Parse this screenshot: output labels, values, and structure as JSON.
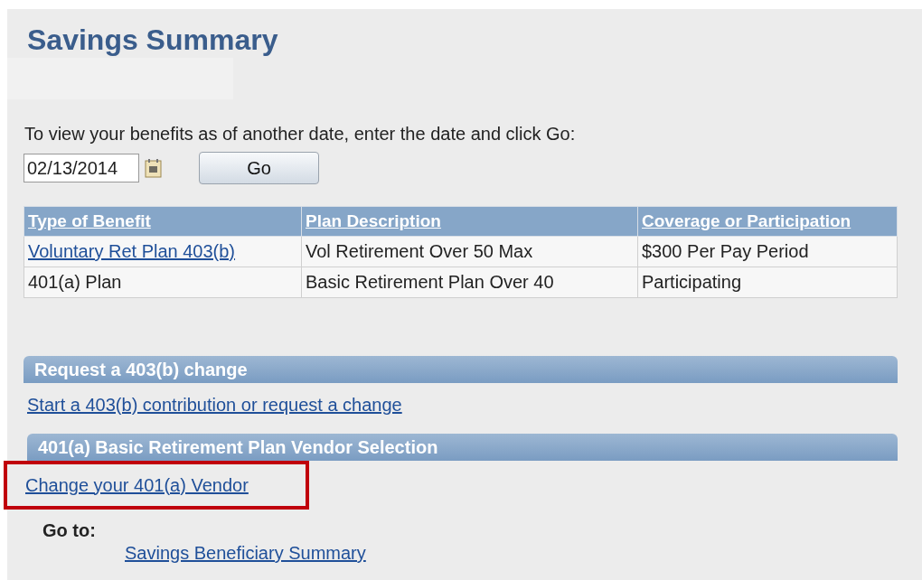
{
  "title": "Savings Summary",
  "date_prompt": "To view your benefits as of another date, enter the date and click Go:",
  "date_field": {
    "value": "02/13/2014",
    "button": "Go"
  },
  "table": {
    "columns": [
      "Type of Benefit",
      "Plan Description",
      "Coverage or Participation"
    ],
    "rows": [
      {
        "cells": [
          "Voluntary Ret Plan 403(b)",
          "Vol Retirement Over 50 Max",
          "$300 Per Pay Period"
        ],
        "link_first": true
      },
      {
        "cells": [
          "401(a) Plan",
          "Basic Retirement Plan Over 40",
          "Participating"
        ],
        "link_first": false
      }
    ]
  },
  "sections": [
    {
      "heading": "Request a 403(b) change",
      "link": "Start a 403(b) contribution or request a change",
      "highlighted": false
    },
    {
      "heading": "401(a) Basic Retirement Plan Vendor Selection",
      "link": "Change your 401(a) Vendor",
      "highlighted": true
    }
  ],
  "goto": {
    "label": "Go to:",
    "links": [
      "Savings Beneficiary Summary"
    ]
  }
}
